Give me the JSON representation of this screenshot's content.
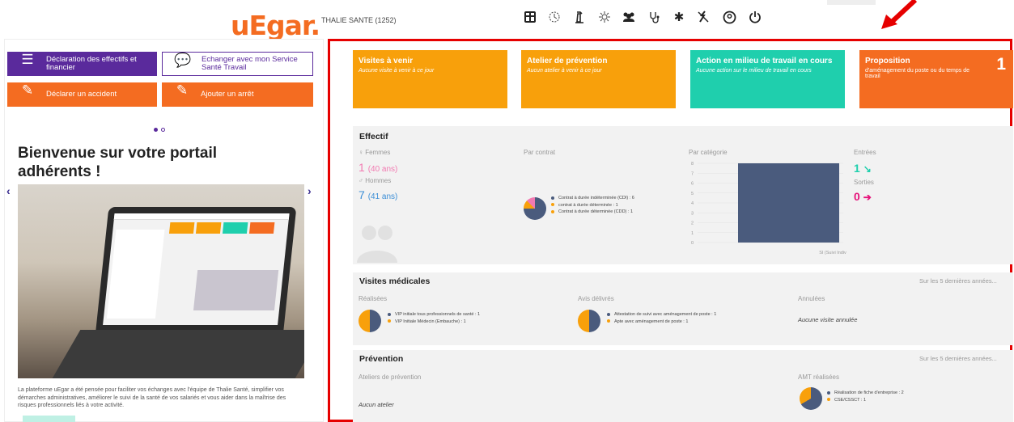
{
  "header": {
    "logo": "uEgar.",
    "org": "THALIE SANTE (1252)",
    "icons": [
      "dashboard-icon",
      "history-icon",
      "fire-extinguisher-icon",
      "virus-icon",
      "team-icon",
      "stethoscope-icon",
      "settings-icon",
      "no-flash-icon",
      "user-icon",
      "power-icon"
    ]
  },
  "quick": {
    "declaration": "Déclaration des effectifs et financier",
    "echanger": "Echanger avec mon Service Santé Travail",
    "accident": "Déclarer un accident",
    "arret": "Ajouter un arrêt"
  },
  "welcome": "Bienvenue sur votre portail adhérents !",
  "blurb": "La plateforme uEgar a été pensée pour faciliter vos échanges avec l'équipe de Thalie Santé, simplifier vos démarches administratives, améliorer le suivi de la santé de vos salariés et vous aider dans la maîtrise des risques professionnels liés à votre activité.",
  "cards": [
    {
      "title": "Visites à venir",
      "sub": "Aucune visite à venir à ce jour",
      "color": "#f8a00b"
    },
    {
      "title": "Atelier de prévention",
      "sub": "Aucun atelier à venir à ce jour",
      "color": "#f8a00b"
    },
    {
      "title": "Action en milieu de travail en cours",
      "sub": "Aucune action sur le milieu de travail en cours",
      "color": "#1fcfad"
    },
    {
      "title": "Proposition",
      "sub": "d'aménagement du poste ou du temps de travail",
      "count": "1",
      "color": "#f46c21"
    }
  ],
  "effectif": {
    "title": "Effectif",
    "femmes_label": "♀ Femmes",
    "femmes_count": "1",
    "femmes_age": "(40 ans)",
    "hommes_label": "♂ Hommes",
    "hommes_count": "7",
    "hommes_age": "(41 ans)",
    "par_contrat": "Par contrat",
    "contrats": [
      "Contrat à durée indéterminée (CDI) : 6",
      "contrat à durée déterminée : 1",
      "Contrat à durée déterminée (CDD) : 1"
    ],
    "par_categorie": "Par catégorie",
    "entrees_label": "Entrées",
    "entrees_count": "1",
    "sorties_label": "Sorties",
    "sorties_count": "0"
  },
  "chart_data": {
    "type": "bar",
    "categories": [
      "SI (Suivi Indiv"
    ],
    "values": [
      8
    ],
    "ylim": [
      0,
      8
    ],
    "yticks": [
      "8",
      "7",
      "6",
      "5",
      "4",
      "3",
      "2",
      "1",
      "0"
    ]
  },
  "visites": {
    "title": "Visites médicales",
    "more": "Sur les 5 dernières années...",
    "realisees_label": "Réalisées",
    "realisees": [
      "VIP initiale tous professionnels de santé : 1",
      "VIP Initiale Médecin (Embauche) : 1"
    ],
    "avis_label": "Avis délivrés",
    "avis": [
      "Attestation de suivi avec aménagement de poste : 1",
      "Apte avec aménagement de poste : 1"
    ],
    "annulees_label": "Annulées",
    "annulees_text": "Aucune visite annulée"
  },
  "prevention": {
    "title": "Prévention",
    "more": "Sur les 5 dernières années...",
    "ateliers_label": "Ateliers de prévention",
    "ateliers_text": "Aucun atelier",
    "amt_label": "AMT réalisées",
    "amt": [
      "Réalisation de fiche d'entreprise : 2",
      "CSE/CSSCT : 1"
    ]
  },
  "colors": {
    "navy": "#4a5b7d",
    "orange": "#f8a00b",
    "pink": "#f27ab1",
    "blue": "#3b8ed6",
    "teal": "#1fcfad",
    "accent": "#f46c21",
    "purple": "#5a2a9c",
    "red_frame": "#e60000"
  }
}
